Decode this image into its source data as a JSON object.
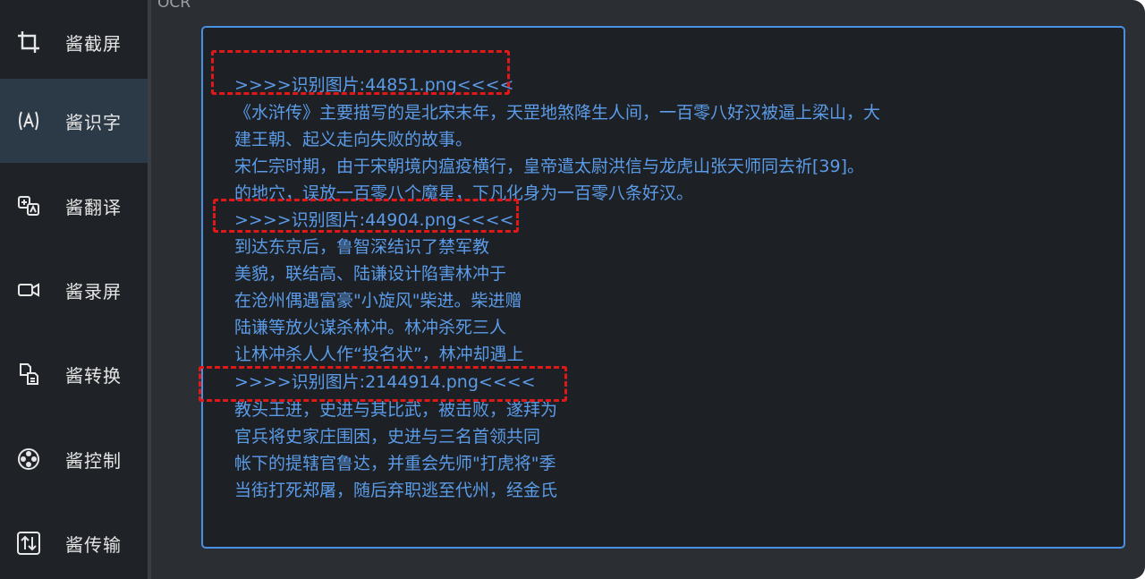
{
  "section_title": "OCR",
  "sidebar": {
    "items": [
      {
        "label": "酱截屏",
        "icon": "crop-icon"
      },
      {
        "label": "酱识字",
        "icon": "text-recognition-icon"
      },
      {
        "label": "酱翻译",
        "icon": "translate-icon"
      },
      {
        "label": "酱录屏",
        "icon": "video-camera-icon"
      },
      {
        "label": "酱转换",
        "icon": "file-convert-icon"
      },
      {
        "label": "酱控制",
        "icon": "control-pad-icon"
      },
      {
        "label": "酱传输",
        "icon": "transfer-icon"
      }
    ],
    "active_index": 1
  },
  "ocr": {
    "lines": [
      ">>>>识别图片:44851.png<<<<",
      "《水浒传》主要描写的是北宋末年，天罡地煞降生人间，一百零八好汉被逼上梁山，大",
      "建王朝、起义走向失败的故事。",
      "宋仁宗时期，由于宋朝境内瘟疫横行，皇帝遣太尉洪信与龙虎山张天师同去祈[39]。",
      "的地穴，误放一百零八个魔星，下凡化身为一百零八条好汉。",
      ">>>>识别图片:44904.png<<<<",
      "到达东京后，鲁智深结识了禁军教",
      "美貌，联结高、陆谦设计陷害林冲于",
      "在沧州偶遇富豪\"小旋风\"柴进。柴进赠",
      "陆谦等放火谋杀林冲。林冲杀死三人",
      "让林冲杀人人作“投名状”，林冲却遇上",
      ">>>>识别图片:2144914.png<<<<",
      "教头王进，史进与其比武，被击败，遂拜为",
      "官兵将史家庄围困，史进与三名首领共同",
      "帐下的提辖官鲁达，并重会先师\"打虎将\"季",
      "当街打死郑屠，随后弃职逃至代州，经金氏"
    ]
  },
  "colors": {
    "text": "#5b9be8",
    "panel_border": "#4a90e2",
    "highlight": "#e01818",
    "sidebar_active": "#2c3947"
  }
}
